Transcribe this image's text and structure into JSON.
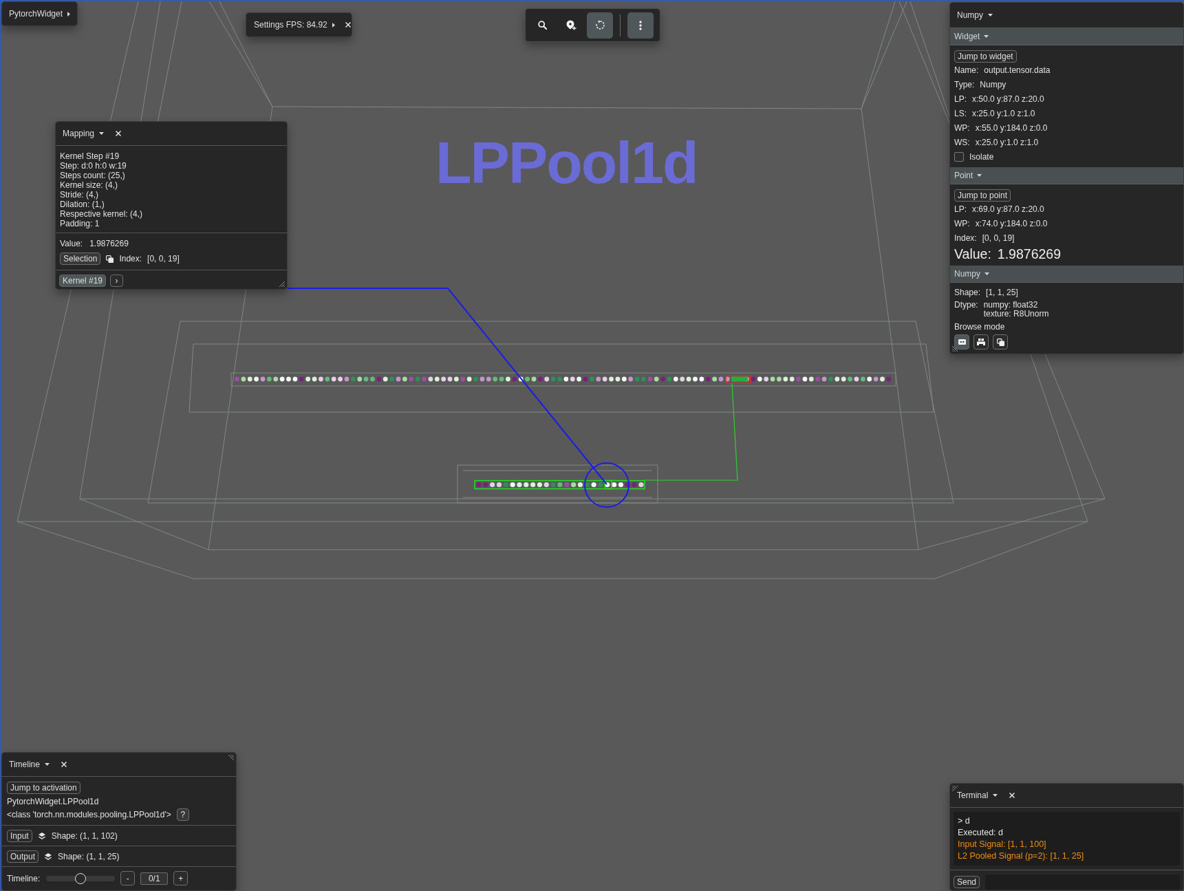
{
  "menu_button": {
    "label": "PytorchWidget"
  },
  "settings": {
    "label": "Settings FPS: 84.92"
  },
  "toolbar": {
    "groups": [
      {
        "buttons": [
          {
            "kind": "search",
            "selected": false
          },
          {
            "kind": "marker",
            "selected": false
          },
          {
            "kind": "refresh",
            "selected": true
          }
        ]
      },
      {
        "buttons": [
          {
            "kind": "more",
            "selected": true
          }
        ]
      }
    ]
  },
  "scene": {
    "title": "LPPool1d"
  },
  "mapping_panel": {
    "title": "Mapping",
    "lines": [
      "Kernel Step #19",
      "Step: d:0 h:0 w:19",
      "Steps count: (25,)",
      "Kernel size: (4,)",
      "Stride: (4,)",
      "Dilation: (1,)",
      "Respective kernel: (4,)",
      "Padding: 1"
    ],
    "value": {
      "label": "Value:",
      "value": "1.9876269"
    },
    "selection_button": "Selection",
    "index": {
      "label": "Index:",
      "value": "[0, 0, 19]"
    },
    "kernel_button": "Kernel #19",
    "next_button": "›"
  },
  "inspector": {
    "title": "Numpy",
    "widget_section": {
      "title": "Widget",
      "jump_button": "Jump to widget",
      "fields": [
        {
          "label": "Name:",
          "value": "output.tensor.data"
        },
        {
          "label": "Type:",
          "value": "Numpy"
        },
        {
          "label": "LP:",
          "value": "x:50.0 y:87.0 z:20.0"
        },
        {
          "label": "LS:",
          "value": "x:25.0 y:1.0 z:1.0"
        },
        {
          "label": "WP:",
          "value": "x:55.0 y:184.0 z:0.0"
        },
        {
          "label": "WS:",
          "value": "x:25.0 y:1.0 z:1.0"
        }
      ],
      "isolate": {
        "label": "Isolate",
        "checked": false
      }
    },
    "point_section": {
      "title": "Point",
      "jump_button": "Jump to point",
      "fields": [
        {
          "label": "LP:",
          "value": "x:69.0 y:87.0 z:20.0"
        },
        {
          "label": "WP:",
          "value": "x:74.0 y:184.0 z:0.0"
        },
        {
          "label": "Index:",
          "value": "[0, 0, 19]"
        }
      ],
      "value": {
        "label": "Value:",
        "value": "1.9876269"
      }
    },
    "numpy_section": {
      "title": "Numpy",
      "fields": [
        {
          "label": "Shape:",
          "lines": [
            "[1, 1, 25]"
          ]
        },
        {
          "label": "Dtype:",
          "lines": [
            "numpy: float32",
            "texture: R8Unorm"
          ]
        }
      ],
      "browse_mode": {
        "label": "Browse mode",
        "buttons": [
          {
            "kind": "tile",
            "selected": true
          },
          {
            "kind": "blocks",
            "selected": false
          },
          {
            "kind": "copy",
            "selected": false
          }
        ]
      }
    }
  },
  "timeline_panel": {
    "title": "Timeline",
    "jump_button": "Jump to activation",
    "module": "PytorchWidget.LPPool1d",
    "class_name": "<class 'torch.nn.modules.pooling.LPPool1d'>",
    "help_button": "?",
    "tensors": [
      {
        "button": "Input",
        "shape": "Shape: (1, 1, 102)"
      },
      {
        "button": "Output",
        "shape": "Shape: (1, 1, 25)"
      }
    ],
    "slider": {
      "label": "Timeline:",
      "level": 0.5
    },
    "minus_button": "-",
    "counter": "0/1",
    "plus_button": "+"
  },
  "terminal": {
    "title": "Terminal",
    "lines": [
      {
        "text": "> d",
        "kind": "plain"
      },
      {
        "text": "Executed: d",
        "kind": "plain"
      },
      {
        "text": "Input Signal: [1, 1, 100]",
        "kind": "highlight"
      },
      {
        "text": "L2 Pooled Signal (p=2): [1, 1, 25]",
        "kind": "highlight"
      }
    ],
    "send_button": "Send"
  }
}
